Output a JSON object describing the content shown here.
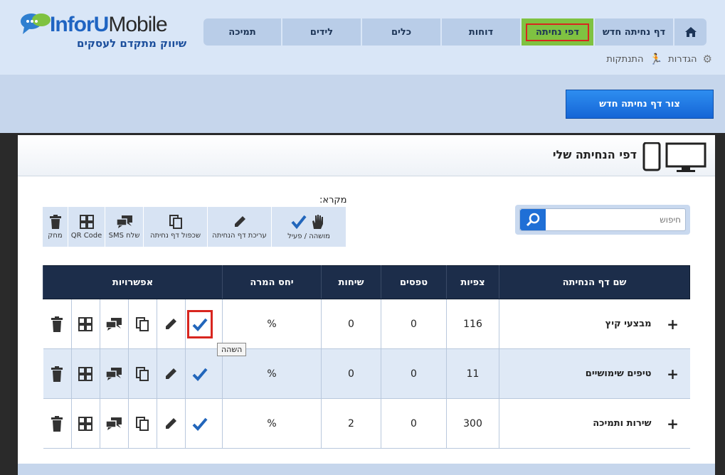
{
  "brand": {
    "name_inforu": "InforU",
    "name_mobile": "Mobile",
    "tagline": "שיווק מתקדם לעסקים"
  },
  "nav": {
    "items": [
      {
        "label": "תמיכה"
      },
      {
        "label": "לידים"
      },
      {
        "label": "כלים"
      },
      {
        "label": "דוחות"
      },
      {
        "label": "דפי נחיתה"
      },
      {
        "label": "דף נחיתה חדש"
      }
    ],
    "active_index": 4
  },
  "subnav": {
    "settings": "הגדרות",
    "logout": "התנתקות"
  },
  "create_button": "צור דף נחיתה חדש",
  "panel": {
    "title": "דפי הנחיתה שלי"
  },
  "search": {
    "placeholder": "חיפוש"
  },
  "legend": {
    "title": "מקרא:",
    "items": [
      {
        "label": "מחק",
        "icon": "trash-icon"
      },
      {
        "label": "QR Code",
        "icon": "qr-icon"
      },
      {
        "label": "שלח SMS",
        "icon": "sms-icon"
      },
      {
        "label": "שכפול דף נחיתה",
        "icon": "copy-icon"
      },
      {
        "label": "עריכת דף הנחיתה",
        "icon": "pencil-icon"
      },
      {
        "label": "מושהה / פעיל",
        "icon": "check-hand-icon"
      }
    ]
  },
  "table": {
    "headers": {
      "name": "שם דף הנחיתה",
      "views": "צפיות",
      "forms": "טפסים",
      "calls": "שיחות",
      "conversion": "יחס המרה",
      "options": "אפשרויות"
    },
    "rows": [
      {
        "name": "מבצעי קיץ",
        "views": "116",
        "forms": "0",
        "calls": "0",
        "conversion": "%"
      },
      {
        "name": "טיפים שימושיים",
        "views": "11",
        "forms": "0",
        "calls": "0",
        "conversion": "%"
      },
      {
        "name": "שירות ותמיכה",
        "views": "300",
        "forms": "0",
        "calls": "2",
        "conversion": "%"
      }
    ],
    "plus": "+"
  },
  "tooltip": "השהה",
  "colors": {
    "nav_active": "#7fc241",
    "header_dark": "#1c2d4a",
    "primary_blue": "#1f6fd6",
    "highlight_red": "#d8261f"
  }
}
